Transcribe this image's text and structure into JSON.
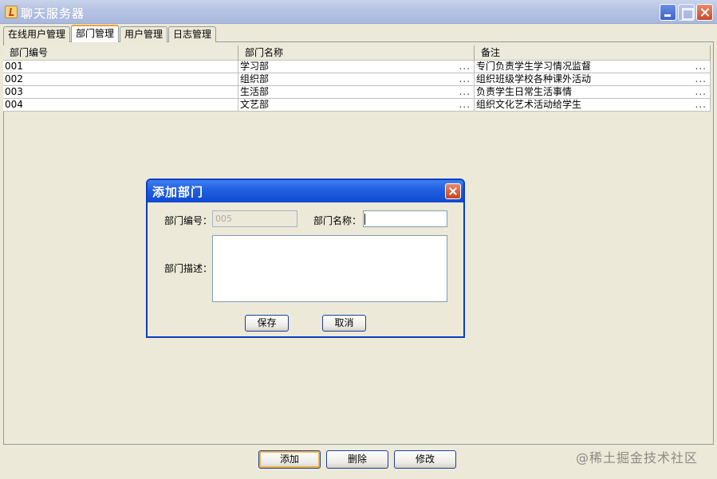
{
  "window": {
    "title": "聊天服务器"
  },
  "tabs": [
    {
      "label": "在线用户管理"
    },
    {
      "label": "部门管理"
    },
    {
      "label": "用户管理"
    },
    {
      "label": "日志管理"
    }
  ],
  "table": {
    "columns": [
      "部门编号",
      "部门名称",
      "备注"
    ],
    "rows": [
      [
        "001",
        "学习部",
        "专门负责学生学习情况监督"
      ],
      [
        "002",
        "组织部",
        "组织班级学校各种课外活动"
      ],
      [
        "003",
        "生活部",
        "负责学生日常生活事情"
      ],
      [
        "004",
        "文艺部",
        "组织文化艺术活动给学生"
      ]
    ],
    "ellipsis": "..."
  },
  "buttons": {
    "add": "添加",
    "delete": "删除",
    "modify": "修改"
  },
  "dialog": {
    "title": "添加部门",
    "id_label": "部门编号：",
    "id_value": "005",
    "name_label": "部门名称：",
    "name_value": "",
    "desc_label": "部门描述：",
    "desc_value": "",
    "save": "保存",
    "cancel": "取消"
  },
  "watermark": "@稀土掘金技术社区"
}
